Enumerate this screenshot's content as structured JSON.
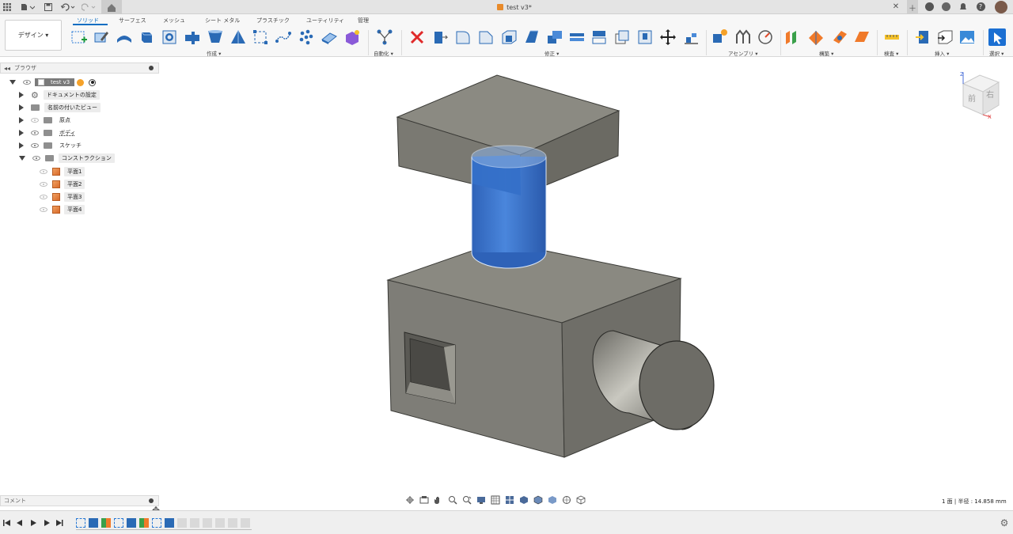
{
  "titlebar": {
    "doc_title": "test v3*",
    "icons": [
      "app-grid-icon",
      "file-menu-icon",
      "save-icon",
      "undo-icon",
      "redo-icon",
      "home-icon",
      "close-tab-icon",
      "new-tab-icon",
      "extensions-icon",
      "jobs-icon",
      "notifications-icon",
      "help-icon",
      "user-avatar"
    ]
  },
  "ribbon": {
    "workspace_label": "デザイン ▾",
    "tabs": [
      "ソリッド",
      "サーフェス",
      "メッシュ",
      "シート メタル",
      "プラスチック",
      "ユーティリティ",
      "管理"
    ],
    "active_tab": "ソリッド",
    "groups": {
      "create": "作成 ▾",
      "automate": "自動化 ▾",
      "modify": "修正 ▾",
      "assemble": "アセンブリ ▾",
      "construct": "構築 ▾",
      "inspect": "検査 ▾",
      "insert": "挿入 ▾",
      "select": "選択 ▾"
    }
  },
  "browser": {
    "title": "ブラウザ",
    "root": "test v3",
    "items": [
      {
        "label": "ドキュメントの設定"
      },
      {
        "label": "名前の付いたビュー"
      },
      {
        "label": "原点"
      },
      {
        "label": "ボディ"
      },
      {
        "label": "スケッチ"
      },
      {
        "label": "コンストラクション"
      }
    ],
    "planes": [
      "平面1",
      "平面2",
      "平面3",
      "平面4"
    ]
  },
  "viewcube": {
    "front": "前",
    "right": "右",
    "z": "Z",
    "x": "X"
  },
  "status": {
    "text": "1 面 | 半径 : 14.858 mm"
  },
  "comments": {
    "label": "コメント"
  },
  "colors": {
    "accent": "#0a6dc2",
    "body_gray": "#7e7d77",
    "selected_blue": "#3a72c8"
  }
}
